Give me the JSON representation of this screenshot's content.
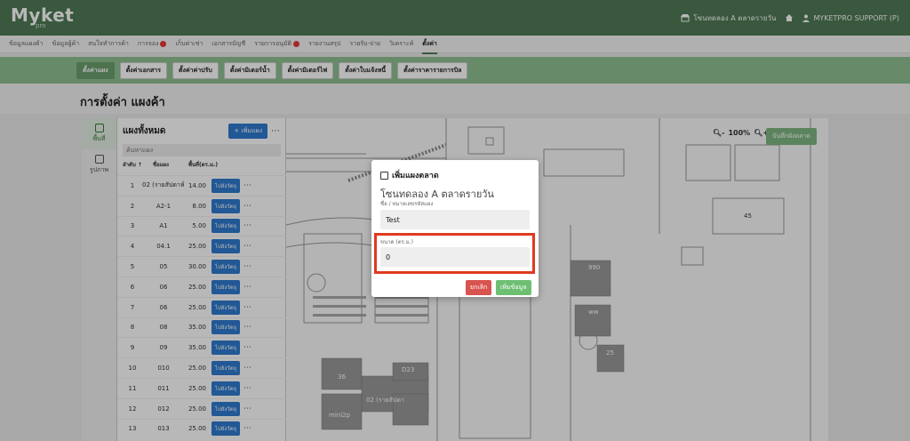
{
  "header": {
    "logo": "Myket",
    "logo_sub": "pro",
    "market_name": "โซนทดลอง A ตลาดรายวัน",
    "user": "MYKETPRO SUPPORT (P)"
  },
  "nav": {
    "items": [
      {
        "label": "ข้อมูลแผงค้า",
        "badge": false
      },
      {
        "label": "ข้อมูลผู้ค้า",
        "badge": false
      },
      {
        "label": "สนใจทำการค้า",
        "badge": false
      },
      {
        "label": "การจอง",
        "badge": true
      },
      {
        "label": "เก็บค่าเช่า",
        "badge": false
      },
      {
        "label": "เอกสารบัญชี",
        "badge": false
      },
      {
        "label": "รายการอนุมัติ",
        "badge": true
      },
      {
        "label": "รายงานสรุป",
        "badge": false
      },
      {
        "label": "รายรับ-จ่าย",
        "badge": false
      },
      {
        "label": "วิเคราะห์",
        "badge": false
      },
      {
        "label": "ตั้งค่า",
        "badge": false,
        "active": true
      }
    ]
  },
  "subnav": {
    "items": [
      {
        "label": "ตั้งค่าแผง",
        "active": true
      },
      {
        "label": "ตั้งค่าเอกสาร"
      },
      {
        "label": "ตั้งค่าค่าปรับ"
      },
      {
        "label": "ตั้งค่ามิเตอร์น้ำ"
      },
      {
        "label": "ตั้งค่ามิเตอร์ไฟ"
      },
      {
        "label": "ตั้งค่าใบแจ้งหนี้"
      },
      {
        "label": "ตั้งค่าราคารายการบิล"
      }
    ]
  },
  "page": {
    "title": "การตั้งค่า แผงค้า"
  },
  "tools": [
    {
      "label": "พื้นที่",
      "icon": "area-icon",
      "active": true
    },
    {
      "label": "รูปภาพ",
      "icon": "image-icon",
      "active": false
    }
  ],
  "stall_panel": {
    "title": "แผงทั้งหมด",
    "add_label": "+ เพิ่มแผง",
    "search_placeholder": "ค้นหาแผง",
    "columns": [
      "ลำดับ ↑",
      "ชื่อแผง",
      "พื้นที่(ตร.ม.)"
    ],
    "action_label": "ไปยังวัตถุ",
    "rows": [
      {
        "no": "1",
        "name": "02 (รายสัปดาห์)",
        "area": "14.00"
      },
      {
        "no": "2",
        "name": "A2-1",
        "area": "8.00"
      },
      {
        "no": "3",
        "name": "A1",
        "area": "5.00"
      },
      {
        "no": "4",
        "name": "04.1",
        "area": "25.00"
      },
      {
        "no": "5",
        "name": "05",
        "area": "30.00"
      },
      {
        "no": "6",
        "name": "06",
        "area": "25.00"
      },
      {
        "no": "7",
        "name": "06",
        "area": "25.00"
      },
      {
        "no": "8",
        "name": "08",
        "area": "35.00"
      },
      {
        "no": "9",
        "name": "09",
        "area": "35.00"
      },
      {
        "no": "10",
        "name": "010",
        "area": "25.00"
      },
      {
        "no": "11",
        "name": "011",
        "area": "25.00"
      },
      {
        "no": "12",
        "name": "012",
        "area": "25.00"
      },
      {
        "no": "13",
        "name": "013",
        "area": "25.00"
      }
    ]
  },
  "map": {
    "zoom": "100%",
    "save_label": "บันทึกผังตลาด",
    "labels": {
      "a": "990",
      "b": "ww",
      "c": "45",
      "d": "25",
      "e": "36",
      "f": "D23",
      "g": "02 (รายสัปดา",
      "h": "mini2p"
    }
  },
  "modal": {
    "title": "เพิ่มแผงตลาด",
    "market": "โซนทดลอง A ตลาดรายวัน",
    "name_label": "ชื่อ / หมายเลขรหัสแผง",
    "name_value": "Test",
    "size_label": "ขนาด (ตร.ม.)",
    "size_value": "0",
    "cancel_label": "ยกเลิก",
    "save_label": "เพิ่มข้อมูล"
  },
  "colors": {
    "brand": "#4f7a55",
    "primary_btn": "#2e7bcf",
    "danger": "#d9534f",
    "success": "#6fbf73",
    "highlight": "#e03a1e"
  }
}
